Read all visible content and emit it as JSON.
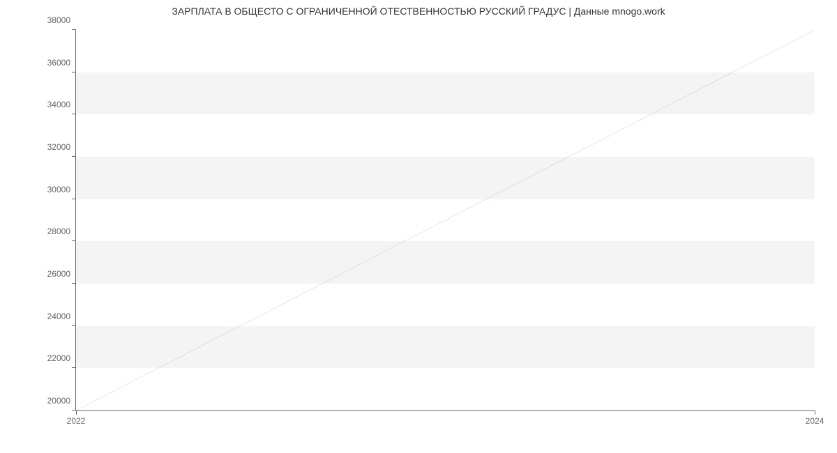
{
  "chart_data": {
    "type": "line",
    "title": "ЗАРПЛАТА В ОБЩЕСТО С ОГРАНИЧЕННОЙ ОТЕСТВЕННОСТЬЮ РУССКИЙ ГРАДУС | Данные mnogo.work",
    "x": [
      2022,
      2024
    ],
    "values": [
      20000,
      38000
    ],
    "xlabel": "",
    "ylabel": "",
    "x_ticks": [
      2022,
      2024
    ],
    "y_ticks": [
      20000,
      22000,
      24000,
      26000,
      28000,
      30000,
      32000,
      34000,
      36000,
      38000
    ],
    "ylim": [
      20000,
      38000
    ],
    "xlim": [
      2022,
      2024
    ],
    "line_color": "#6699e8"
  }
}
